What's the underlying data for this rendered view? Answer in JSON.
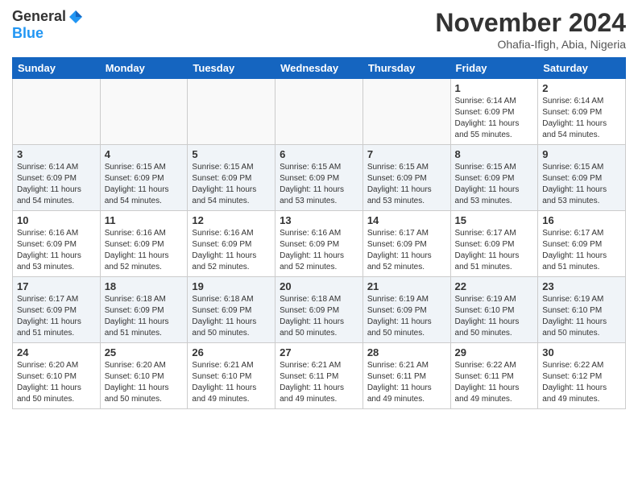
{
  "logo": {
    "general": "General",
    "blue": "Blue"
  },
  "title": "November 2024",
  "location": "Ohafia-Ifigh, Abia, Nigeria",
  "weekdays": [
    "Sunday",
    "Monday",
    "Tuesday",
    "Wednesday",
    "Thursday",
    "Friday",
    "Saturday"
  ],
  "weeks": [
    [
      {
        "day": "",
        "info": ""
      },
      {
        "day": "",
        "info": ""
      },
      {
        "day": "",
        "info": ""
      },
      {
        "day": "",
        "info": ""
      },
      {
        "day": "",
        "info": ""
      },
      {
        "day": "1",
        "info": "Sunrise: 6:14 AM\nSunset: 6:09 PM\nDaylight: 11 hours\nand 55 minutes."
      },
      {
        "day": "2",
        "info": "Sunrise: 6:14 AM\nSunset: 6:09 PM\nDaylight: 11 hours\nand 54 minutes."
      }
    ],
    [
      {
        "day": "3",
        "info": "Sunrise: 6:14 AM\nSunset: 6:09 PM\nDaylight: 11 hours\nand 54 minutes."
      },
      {
        "day": "4",
        "info": "Sunrise: 6:15 AM\nSunset: 6:09 PM\nDaylight: 11 hours\nand 54 minutes."
      },
      {
        "day": "5",
        "info": "Sunrise: 6:15 AM\nSunset: 6:09 PM\nDaylight: 11 hours\nand 54 minutes."
      },
      {
        "day": "6",
        "info": "Sunrise: 6:15 AM\nSunset: 6:09 PM\nDaylight: 11 hours\nand 53 minutes."
      },
      {
        "day": "7",
        "info": "Sunrise: 6:15 AM\nSunset: 6:09 PM\nDaylight: 11 hours\nand 53 minutes."
      },
      {
        "day": "8",
        "info": "Sunrise: 6:15 AM\nSunset: 6:09 PM\nDaylight: 11 hours\nand 53 minutes."
      },
      {
        "day": "9",
        "info": "Sunrise: 6:15 AM\nSunset: 6:09 PM\nDaylight: 11 hours\nand 53 minutes."
      }
    ],
    [
      {
        "day": "10",
        "info": "Sunrise: 6:16 AM\nSunset: 6:09 PM\nDaylight: 11 hours\nand 53 minutes."
      },
      {
        "day": "11",
        "info": "Sunrise: 6:16 AM\nSunset: 6:09 PM\nDaylight: 11 hours\nand 52 minutes."
      },
      {
        "day": "12",
        "info": "Sunrise: 6:16 AM\nSunset: 6:09 PM\nDaylight: 11 hours\nand 52 minutes."
      },
      {
        "day": "13",
        "info": "Sunrise: 6:16 AM\nSunset: 6:09 PM\nDaylight: 11 hours\nand 52 minutes."
      },
      {
        "day": "14",
        "info": "Sunrise: 6:17 AM\nSunset: 6:09 PM\nDaylight: 11 hours\nand 52 minutes."
      },
      {
        "day": "15",
        "info": "Sunrise: 6:17 AM\nSunset: 6:09 PM\nDaylight: 11 hours\nand 51 minutes."
      },
      {
        "day": "16",
        "info": "Sunrise: 6:17 AM\nSunset: 6:09 PM\nDaylight: 11 hours\nand 51 minutes."
      }
    ],
    [
      {
        "day": "17",
        "info": "Sunrise: 6:17 AM\nSunset: 6:09 PM\nDaylight: 11 hours\nand 51 minutes."
      },
      {
        "day": "18",
        "info": "Sunrise: 6:18 AM\nSunset: 6:09 PM\nDaylight: 11 hours\nand 51 minutes."
      },
      {
        "day": "19",
        "info": "Sunrise: 6:18 AM\nSunset: 6:09 PM\nDaylight: 11 hours\nand 50 minutes."
      },
      {
        "day": "20",
        "info": "Sunrise: 6:18 AM\nSunset: 6:09 PM\nDaylight: 11 hours\nand 50 minutes."
      },
      {
        "day": "21",
        "info": "Sunrise: 6:19 AM\nSunset: 6:09 PM\nDaylight: 11 hours\nand 50 minutes."
      },
      {
        "day": "22",
        "info": "Sunrise: 6:19 AM\nSunset: 6:10 PM\nDaylight: 11 hours\nand 50 minutes."
      },
      {
        "day": "23",
        "info": "Sunrise: 6:19 AM\nSunset: 6:10 PM\nDaylight: 11 hours\nand 50 minutes."
      }
    ],
    [
      {
        "day": "24",
        "info": "Sunrise: 6:20 AM\nSunset: 6:10 PM\nDaylight: 11 hours\nand 50 minutes."
      },
      {
        "day": "25",
        "info": "Sunrise: 6:20 AM\nSunset: 6:10 PM\nDaylight: 11 hours\nand 50 minutes."
      },
      {
        "day": "26",
        "info": "Sunrise: 6:21 AM\nSunset: 6:10 PM\nDaylight: 11 hours\nand 49 minutes."
      },
      {
        "day": "27",
        "info": "Sunrise: 6:21 AM\nSunset: 6:11 PM\nDaylight: 11 hours\nand 49 minutes."
      },
      {
        "day": "28",
        "info": "Sunrise: 6:21 AM\nSunset: 6:11 PM\nDaylight: 11 hours\nand 49 minutes."
      },
      {
        "day": "29",
        "info": "Sunrise: 6:22 AM\nSunset: 6:11 PM\nDaylight: 11 hours\nand 49 minutes."
      },
      {
        "day": "30",
        "info": "Sunrise: 6:22 AM\nSunset: 6:12 PM\nDaylight: 11 hours\nand 49 minutes."
      }
    ]
  ]
}
